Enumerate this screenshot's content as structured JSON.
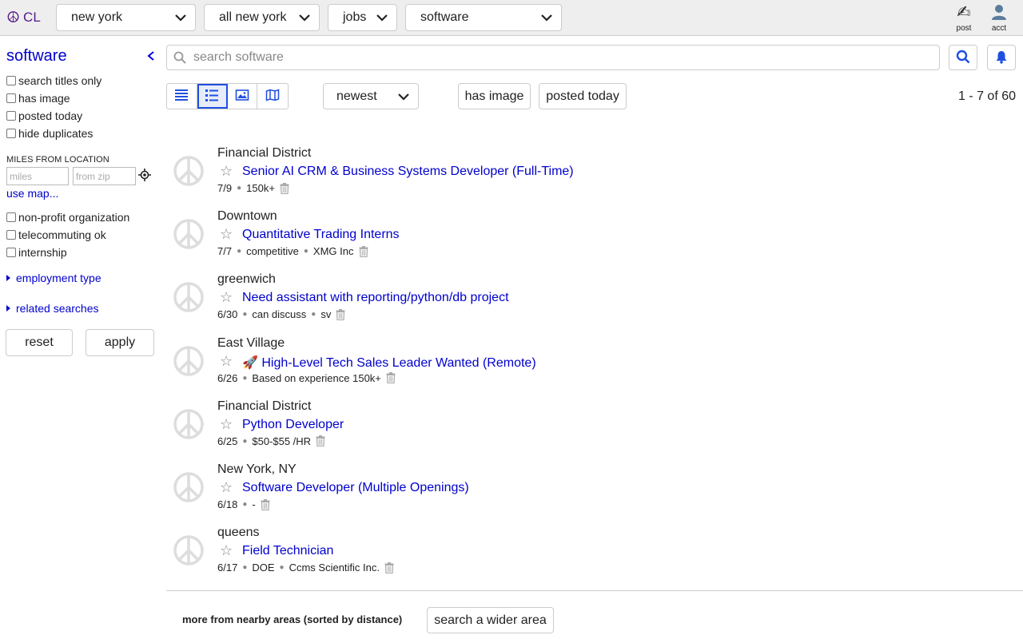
{
  "topbar": {
    "logo_text": "CL",
    "logo_icon": "peace-icon",
    "selects": [
      "new york",
      "all new york",
      "jobs",
      "software"
    ],
    "post_label": "post",
    "acct_label": "acct"
  },
  "sidebar": {
    "title": "software",
    "checkboxes_top": [
      "search titles only",
      "has image",
      "posted today",
      "hide duplicates"
    ],
    "miles_heading": "MILES FROM LOCATION",
    "miles_placeholder": "miles",
    "zip_placeholder": "from zip",
    "use_map": "use map...",
    "checkboxes_bottom": [
      "non-profit organization",
      "telecommuting ok",
      "internship"
    ],
    "employment_type": "employment type",
    "related_searches": "related searches",
    "reset": "reset",
    "apply": "apply"
  },
  "search": {
    "placeholder": "search software"
  },
  "toolbar": {
    "sort": "newest",
    "has_image": "has image",
    "posted_today": "posted today",
    "count": "1 - 7 of 60"
  },
  "results": [
    {
      "location": "Financial District",
      "title": "Senior AI CRM & Business Systems Developer (Full-Time)",
      "date": "7/9",
      "meta": [
        "150k+"
      ]
    },
    {
      "location": "Downtown",
      "title": "Quantitative Trading Interns",
      "date": "7/7",
      "meta": [
        "competitive",
        "XMG Inc"
      ]
    },
    {
      "location": "greenwich",
      "title": "Need assistant with reporting/python/db project",
      "date": "6/30",
      "meta": [
        "can discuss",
        "sv"
      ]
    },
    {
      "location": "East Village",
      "title": "🚀 High-Level Tech Sales Leader Wanted (Remote)",
      "date": "6/26",
      "meta": [
        "Based on experience 150k+"
      ]
    },
    {
      "location": "Financial District",
      "title": "Python Developer",
      "date": "6/25",
      "meta": [
        "$50-$55 /HR"
      ]
    },
    {
      "location": "New York, NY",
      "title": "Software Developer (Multiple Openings)",
      "date": "6/18",
      "meta": [
        "-"
      ]
    },
    {
      "location": "queens",
      "title": "Field Technician",
      "date": "6/17",
      "meta": [
        "DOE",
        "Ccms Scientific Inc."
      ]
    }
  ],
  "footer": {
    "nearby": "more from nearby areas (sorted by distance)",
    "wider": "search a wider area"
  },
  "colors": {
    "link": "#0000cc",
    "logo": "#551a8b",
    "active_view": "#1f4fe0"
  }
}
